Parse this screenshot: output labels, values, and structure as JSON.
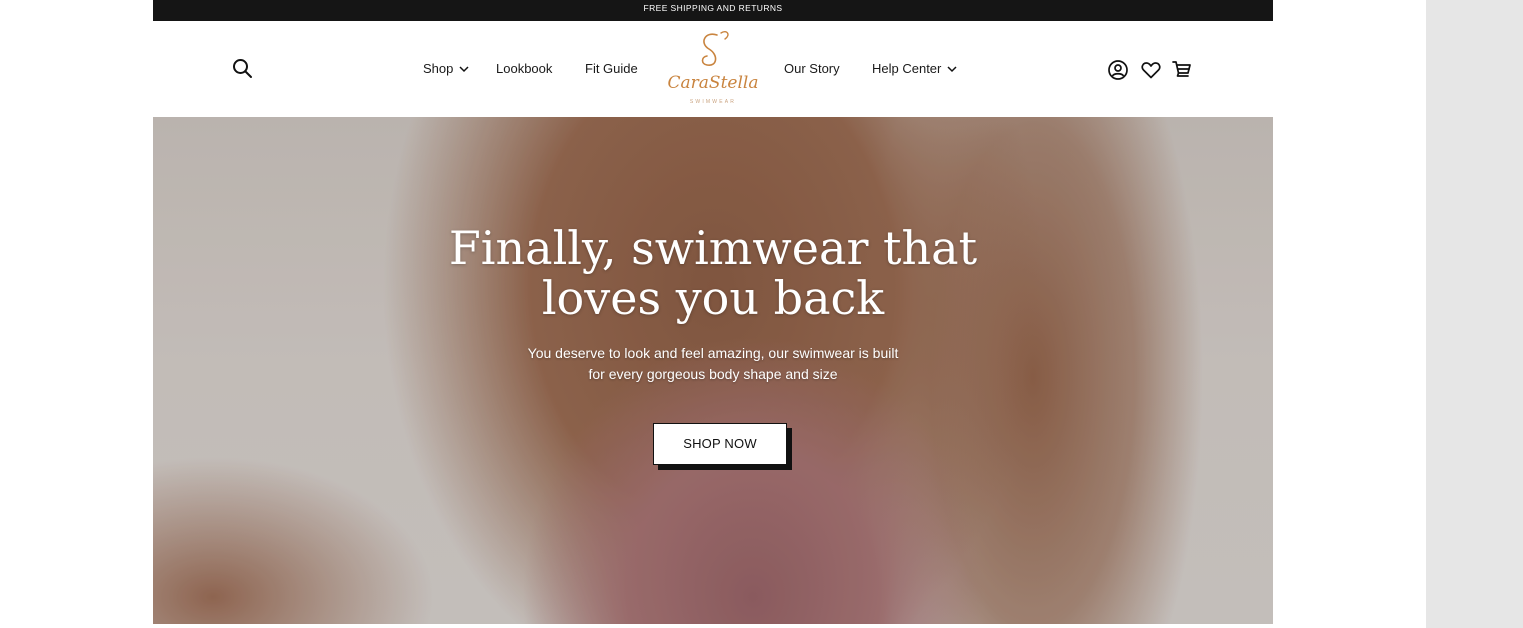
{
  "announcement": "FREE SHIPPING AND RETURNS",
  "nav": {
    "shop": "Shop",
    "lookbook": "Lookbook",
    "fit_guide": "Fit Guide",
    "our_story": "Our Story",
    "help_center": "Help Center"
  },
  "logo": {
    "name": "CaraStella",
    "tagline": "SWIMWEAR",
    "color": "#c9843f"
  },
  "icons": {
    "search": "search-icon",
    "account": "account-icon",
    "wishlist": "heart-icon",
    "cart": "cart-icon"
  },
  "hero": {
    "headline_line1": "Finally, swimwear that",
    "headline_line2": "loves you back",
    "subtext_line1": "You deserve to look and feel amazing, our swimwear is built",
    "subtext_line2": "for every gorgeous body shape and size",
    "cta": "SHOP NOW"
  }
}
